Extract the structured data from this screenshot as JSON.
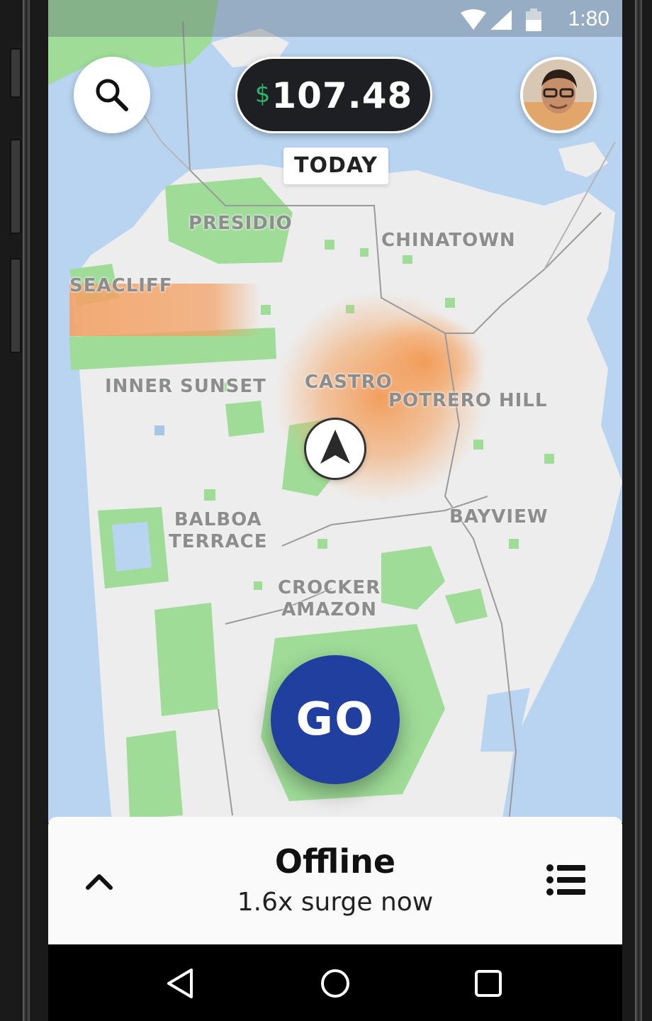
{
  "status_bar": {
    "time": "1:80",
    "icons": [
      "wifi-icon",
      "signal-icon",
      "battery-icon"
    ]
  },
  "header": {
    "search_icon": "search-icon",
    "earnings": {
      "currency": "$",
      "amount": "107.48",
      "period": "TODAY"
    },
    "avatar": "profile-photo"
  },
  "map": {
    "places": [
      {
        "id": "presidio",
        "name": "PRESIDIO"
      },
      {
        "id": "chinatown",
        "name": "CHINATOWN"
      },
      {
        "id": "seacliff",
        "name": "SEACLIFF"
      },
      {
        "id": "inner-sunset",
        "name": "INNER SUNSET"
      },
      {
        "id": "castro",
        "name": "CASTRO"
      },
      {
        "id": "potrero-hill",
        "name": "POTRERO HILL"
      },
      {
        "id": "balboa-terrace",
        "name": "BALBOA\nTERRACE"
      },
      {
        "id": "bayview",
        "name": "BAYVIEW"
      },
      {
        "id": "crocker-amazon",
        "name": "CROCKER\nAMAZON"
      }
    ],
    "colors": {
      "water": "#b9d4f1",
      "land": "#ededed",
      "park": "#9fdc98",
      "surge": "#f2a466"
    }
  },
  "go_button": {
    "label": "GO",
    "color": "#213f9e"
  },
  "bottom_panel": {
    "title": "Offline",
    "subtitle": "1.6x surge now",
    "expand_icon": "chevron-up-icon",
    "menu_icon": "list-icon"
  },
  "system_nav": {
    "keys": [
      "back-icon",
      "home-icon",
      "recents-icon"
    ]
  }
}
